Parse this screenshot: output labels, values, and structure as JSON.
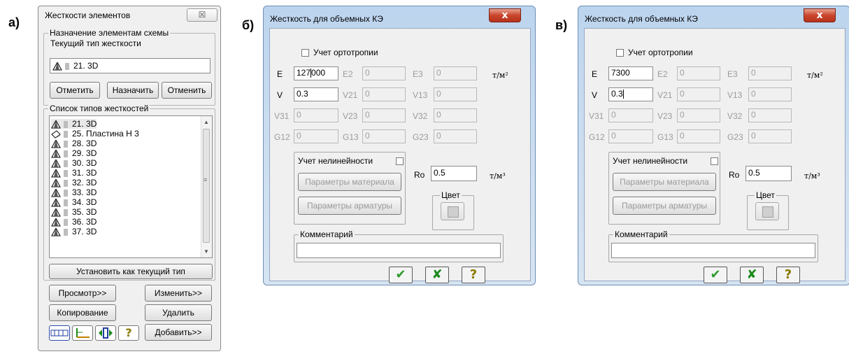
{
  "labels": {
    "a": "а)",
    "b": "б)",
    "c": "в)"
  },
  "panel_a": {
    "title": "Жесткости элементов",
    "close": "☒",
    "assign_group": "Назначение элементам схемы",
    "current_type_label": "Текущий тип жесткости",
    "current_type_value": "21. 3D",
    "btn_mark": "Отметить",
    "btn_assign": "Назначить",
    "btn_cancel": "Отменить",
    "list_group": "Список типов жесткостей",
    "items": [
      "21. 3D",
      "25. Пластина  H 3",
      "28. 3D",
      "29. 3D",
      "30. 3D",
      "31. 3D",
      "32. 3D",
      "33. 3D",
      "34. 3D",
      "35. 3D",
      "36. 3D",
      "37. 3D"
    ],
    "btn_set_current": "Установить как текущий тип",
    "btn_view": "Просмотр>>",
    "btn_change": "Изменить>>",
    "btn_copy": "Копирование",
    "btn_delete": "Удалить",
    "btn_add": "Добавить>>",
    "help": "?"
  },
  "dialogs": [
    {
      "title": "Жесткость для объемных КЭ",
      "close": "x",
      "orthotropy": "Учет ортотропии",
      "E": "E",
      "E_val": "127000",
      "E2": "E2",
      "E2_val": "0",
      "E3": "E3",
      "E3_val": "0",
      "unit_tm2": "т/м²",
      "V": "V",
      "V_val": "0.3",
      "V21": "V21",
      "V21_val": "0",
      "V13": "V13",
      "V13_val": "0",
      "V31": "V31",
      "V31_val": "0",
      "V23": "V23",
      "V23_val": "0",
      "V32": "V32",
      "V32_val": "0",
      "G12": "G12",
      "G12_val": "0",
      "G13": "G13",
      "G13_val": "0",
      "G23": "G23",
      "G23_val": "0",
      "nonlin": "Учет нелинейности",
      "mat_params": "Параметры материала",
      "arm_params": "Параметры арматуры",
      "Ro": "Ro",
      "Ro_val": "0.5",
      "unit_tm3": "т/м³",
      "color": "Цвет",
      "comment": "Комментарий",
      "ok": "✔",
      "cancel": "✘",
      "help": "?"
    },
    {
      "title": "Жесткость для объемных КЭ",
      "close": "x",
      "orthotropy": "Учет ортотропии",
      "E": "E",
      "E_val": "7300",
      "E2": "E2",
      "E2_val": "0",
      "E3": "E3",
      "E3_val": "0",
      "unit_tm2": "т/м²",
      "V": "V",
      "V_val": "0.3",
      "V21": "V21",
      "V21_val": "0",
      "V13": "V13",
      "V13_val": "0",
      "V31": "V31",
      "V31_val": "0",
      "V23": "V23",
      "V23_val": "0",
      "V32": "V32",
      "V32_val": "0",
      "G12": "G12",
      "G12_val": "0",
      "G13": "G13",
      "G13_val": "0",
      "G23": "G23",
      "G23_val": "0",
      "nonlin": "Учет нелинейности",
      "mat_params": "Параметры материала",
      "arm_params": "Параметры арматуры",
      "Ro": "Ro",
      "Ro_val": "0.5",
      "unit_tm3": "т/м³",
      "color": "Цвет",
      "comment": "Комментарий",
      "ok": "✔",
      "cancel": "✘",
      "help": "?"
    }
  ],
  "colors": {
    "ok_green": "#2e9b2e",
    "cancel_green": "#1c8a1c",
    "help_olive": "#8a7a00",
    "close_red": "#c9452c"
  }
}
